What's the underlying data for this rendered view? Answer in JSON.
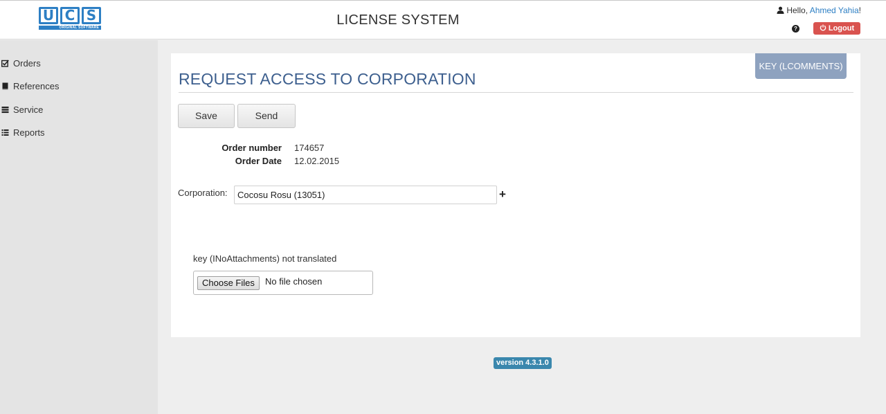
{
  "header": {
    "logo_text": "UCS",
    "logo_subtext": "ORIGINAL SOFTWARE",
    "title": "LICENSE SYSTEM",
    "greeting": "Hello,",
    "user_name": "Ahmed Yahia",
    "greeting_suffix": "!",
    "help_glyph": "?",
    "logout_label": "Logout"
  },
  "sidebar": {
    "items": [
      {
        "label": "Orders",
        "icon": "check-square-icon"
      },
      {
        "label": "References",
        "icon": "book-icon"
      },
      {
        "label": "Service",
        "icon": "hdd-icon"
      },
      {
        "label": "Reports",
        "icon": "list-icon"
      }
    ]
  },
  "panel": {
    "title": "REQUEST ACCESS TO CORPORATION",
    "key_tab": "KEY (LCOMMENTS)",
    "save_label": "Save",
    "send_label": "Send",
    "order_number_label": "Order number",
    "order_number": "174657",
    "order_date_label": "Order Date",
    "order_date": "12.02.2015",
    "corporation_label": "Corporation:",
    "corporation_value": "Cocosu Rosu (13051)",
    "add_glyph": "+",
    "attachments_text": "key (INoAttachments) not translated",
    "choose_files_label": "Choose Files",
    "file_status": "No file chosen"
  },
  "footer": {
    "version": "version 4.3.1.0"
  },
  "colors": {
    "brand_blue": "#2d7fc4",
    "title_blue": "#3d5f8e",
    "logout_red": "#d9534f",
    "version_blue": "#3a87ad"
  }
}
